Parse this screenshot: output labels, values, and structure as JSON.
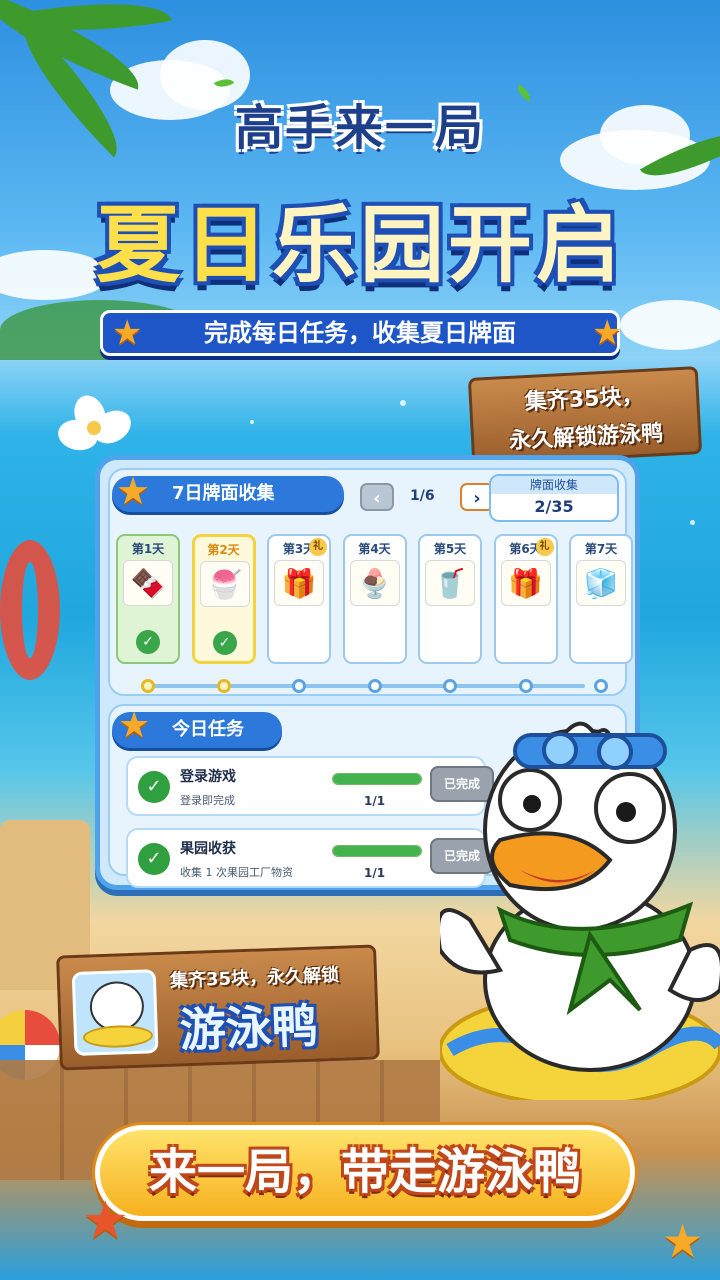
{
  "logo": {
    "text": "高手来一局"
  },
  "headline": {
    "part1": "夏日",
    "part2": "乐园开启"
  },
  "subtitle": "完成每日任务，收集夏日牌面",
  "top_sign": {
    "line1": "集齐35块，",
    "line2": "永久解锁游泳鸭"
  },
  "collection": {
    "title": "7日牌面收集",
    "pager": {
      "prev": "‹",
      "page": "1/6",
      "next": "›"
    },
    "counter_title": "牌面收集",
    "counter_value": "2/35",
    "days": [
      {
        "label": "第1天",
        "item": "🍫",
        "icon": "ice-cream-sandwich-icon",
        "done": true,
        "gift": ""
      },
      {
        "label": "第2天",
        "item": "🍧",
        "icon": "shaved-ice-icon",
        "done": true,
        "gift": ""
      },
      {
        "label": "第3天",
        "item": "🎁",
        "icon": "gift-box-icon",
        "done": false,
        "gift": "礼"
      },
      {
        "label": "第4天",
        "item": "🍨",
        "icon": "sundae-icon",
        "done": false,
        "gift": ""
      },
      {
        "label": "第5天",
        "item": "🥤",
        "icon": "iced-drink-icon",
        "done": false,
        "gift": ""
      },
      {
        "label": "第6天",
        "item": "🎁",
        "icon": "gift-box-icon",
        "done": false,
        "gift": "礼"
      },
      {
        "label": "第7天",
        "item": "🧊",
        "icon": "cooler-box-icon",
        "done": false,
        "gift": ""
      }
    ]
  },
  "tasks": {
    "title": "今日任务",
    "items": [
      {
        "name": "登录游戏",
        "desc": "登录即完成",
        "progress": "1/1",
        "progress_fraction": 1.0,
        "button": "已完成"
      },
      {
        "name": "果园收获",
        "desc": "收集 1 次果园工厂物资",
        "progress": "1/1",
        "progress_fraction": 1.0,
        "button": "已完成"
      }
    ]
  },
  "bottom_sign": {
    "line1": "集齐35块，永久解锁",
    "line2": "游泳鸭"
  },
  "cta": "来一局，带走游泳鸭",
  "colors": {
    "primary_blue": "#2d79db",
    "gold": "#f6b11f",
    "done_green": "#3aa64a"
  }
}
